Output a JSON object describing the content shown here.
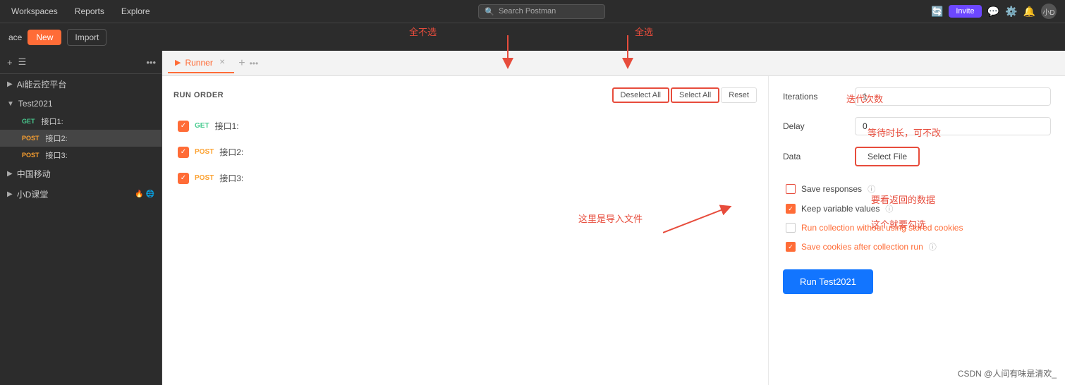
{
  "topNav": {
    "items": [
      "Workspaces",
      "Reports",
      "Explore"
    ],
    "workspacesLabel": "Workspaces",
    "reportsLabel": "Reports",
    "exploreLabel": "Explore",
    "searchPlaceholder": "Search Postman",
    "inviteLabel": "Invite",
    "avatarLabel": "小D"
  },
  "secondNav": {
    "spaceLabel": "ace",
    "newLabel": "New",
    "importLabel": "Import"
  },
  "sidebar": {
    "items": [
      {
        "label": "Ai能云控平台",
        "type": "group",
        "expanded": false
      },
      {
        "label": "Test2021",
        "type": "group",
        "expanded": true
      },
      {
        "label": "接口1:",
        "method": "GET",
        "type": "sub"
      },
      {
        "label": "接口2:",
        "method": "POST",
        "type": "sub",
        "active": true
      },
      {
        "label": "接口3:",
        "method": "POST",
        "type": "sub"
      },
      {
        "label": "中国移动",
        "type": "group",
        "expanded": false
      },
      {
        "label": "小D课堂",
        "type": "group",
        "expanded": false
      }
    ]
  },
  "tab": {
    "label": "Runner",
    "icon": "▶"
  },
  "runner": {
    "runOrderTitle": "RUN ORDER",
    "deselectAllLabel": "Deselect All",
    "selectAllLabel": "Select All",
    "resetLabel": "Reset",
    "requests": [
      {
        "method": "GET",
        "name": "接口1:",
        "checked": true
      },
      {
        "method": "POST",
        "name": "接口2:",
        "checked": true
      },
      {
        "method": "POST",
        "name": "接口3:",
        "checked": true
      }
    ]
  },
  "config": {
    "iterationsLabel": "Iterations",
    "iterationsValue": "1",
    "delayLabel": "Delay",
    "delayValue": "0",
    "dataLabel": "Data",
    "selectFileLabel": "Select File",
    "saveResponsesLabel": "Save responses",
    "keepVariableLabel": "Keep variable values",
    "runWithoutCookiesLabel": "Run collection without using stored cookies",
    "saveCookiesLabel": "Save cookies after collection run",
    "runBtnLabel": "Run Test2021"
  },
  "annotations": {
    "deselectAll": "全不选",
    "selectAll": "全选",
    "importFile": "这里是导入文件",
    "iterationsNote": "迭代次数",
    "delayNote": "等待时长，可不改",
    "saveResponsesNote": "要看返回的数据",
    "keepVariableNote": "这个就要勾选"
  },
  "watermark": "CSDN @人间有味是清欢_"
}
